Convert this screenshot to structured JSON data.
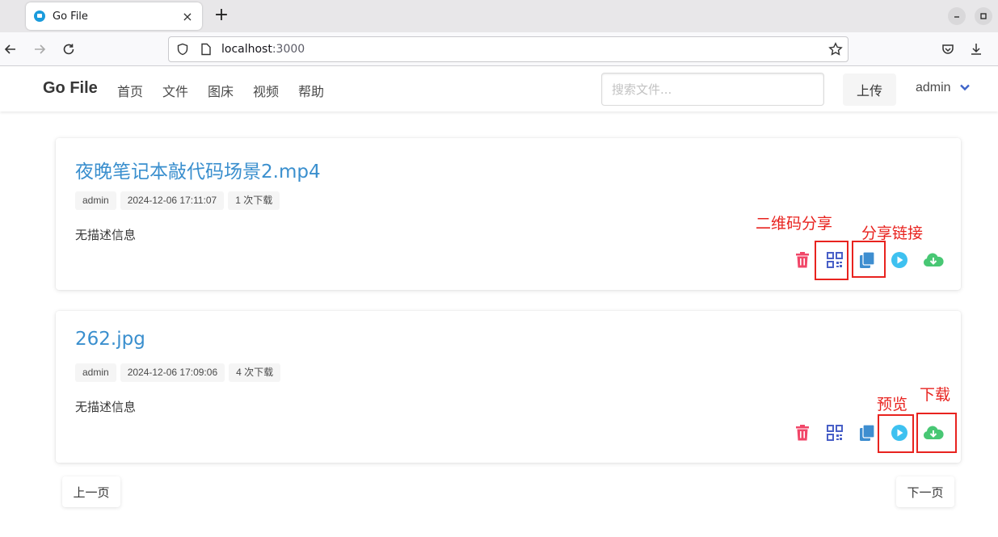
{
  "browser": {
    "tab_title": "Go File",
    "tab_close": "×",
    "new_tab": "+",
    "url_host": "localhost",
    "url_port": ":3000"
  },
  "header": {
    "brand": "Go File",
    "menu": [
      "首页",
      "文件",
      "图床",
      "视频",
      "帮助"
    ],
    "search_placeholder": "搜索文件...",
    "upload_label": "上传",
    "user": "admin"
  },
  "files": [
    {
      "name": "夜晚笔记本敲代码场景2.mp4",
      "owner": "admin",
      "time": "2024-12-06 17:11:07",
      "downloads": "1 次下载",
      "description": "无描述信息"
    },
    {
      "name": "262.jpg",
      "owner": "admin",
      "time": "2024-12-06 17:09:06",
      "downloads": "4 次下载",
      "description": "无描述信息"
    }
  ],
  "annotations": {
    "qr_share": "二维码分享",
    "share_link": "分享链接",
    "preview": "预览",
    "download": "下载"
  },
  "pagination": {
    "prev": "上一页",
    "next": "下一页"
  },
  "colors": {
    "accent": "#3a8fce",
    "delete": "#f14668",
    "qr": "#485fc7",
    "copy": "#3e8ed0",
    "preview": "#3ec1f0",
    "download": "#48c774",
    "annotation": "#e8231f"
  }
}
